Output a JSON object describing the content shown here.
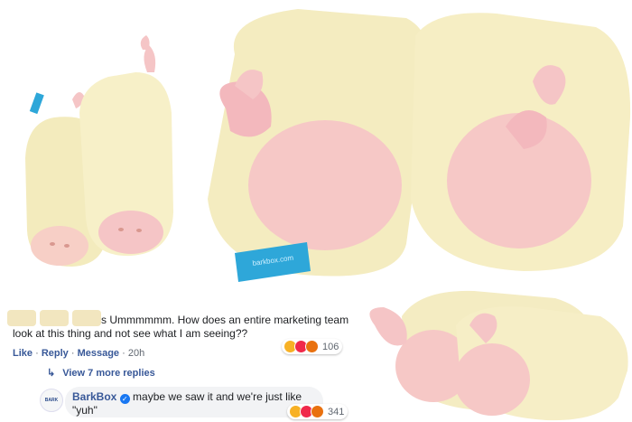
{
  "photos": {
    "toy_pair_standing": "plush toy pair standing upright",
    "toy_pair_closeup": "plush toy pair closeup",
    "toy_pair_lying": "plush toy pair lying down"
  },
  "comment1": {
    "text_line1": "s Ummmmmm. How does an entire marketing team",
    "text_line2": "look at this thing and not see what I am seeing??",
    "like": "Like",
    "reply": "Reply",
    "message": "Message",
    "time": "20h",
    "reaction_count": "106"
  },
  "replies_link": "View 7 more replies",
  "reply": {
    "author": "BarkBox",
    "text_line1": "maybe we saw it and we're just like",
    "text_line2": "\"yuh\"",
    "reaction_count": "341"
  },
  "tag_text": "barkbox.com",
  "colors": {
    "plush": "#f5edbd",
    "pink": "#f5c5c6",
    "tag": "#2ea7d9",
    "fb_link": "#385898",
    "verified": "#1877f2"
  }
}
